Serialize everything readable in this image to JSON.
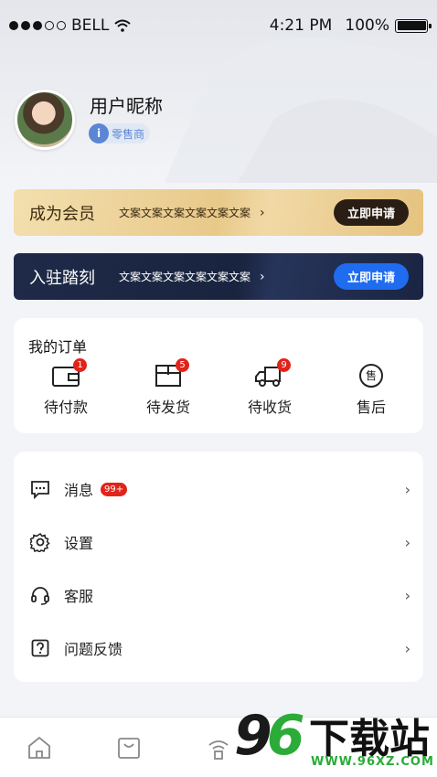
{
  "status_bar": {
    "carrier": "BELL",
    "time": "4:21 PM",
    "battery": "100%",
    "signal_bars_filled": 3,
    "signal_bars_total": 5
  },
  "profile": {
    "nickname": "用户昵称",
    "role_icon_text": "i",
    "role": "零售商"
  },
  "member_banner": {
    "title": "成为会员",
    "desc": "文案文案文案文案文案文案",
    "chevron": "›",
    "button": "立即申请"
  },
  "join_banner": {
    "title": "入驻踏刻",
    "desc": "文案文案文案文案文案文案",
    "chevron": "›",
    "button": "立即申请"
  },
  "orders": {
    "title": "我的订单",
    "items": [
      {
        "label": "待付款",
        "badge": "1",
        "icon": "wallet-icon"
      },
      {
        "label": "待发货",
        "badge": "5",
        "icon": "package-icon"
      },
      {
        "label": "待收货",
        "badge": "9",
        "icon": "truck-icon"
      },
      {
        "label": "售后",
        "badge": "",
        "icon": "after-sale-icon",
        "icon_text": "售"
      }
    ]
  },
  "menu": {
    "items": [
      {
        "label": "消息",
        "badge": "99+",
        "icon": "message-icon"
      },
      {
        "label": "设置",
        "badge": "",
        "icon": "gear-icon"
      },
      {
        "label": "客服",
        "badge": "",
        "icon": "headset-icon"
      },
      {
        "label": "问题反馈",
        "badge": "",
        "icon": "question-icon"
      }
    ],
    "arrow": "›"
  },
  "tabbar": {
    "icons": [
      "home-icon",
      "bag-icon",
      "broadcast-icon"
    ]
  },
  "watermark": {
    "digit1": "9",
    "digit2": "6",
    "text": "下载站",
    "url": "WWW.96XZ.COM"
  },
  "colors": {
    "gold_button": "#2a1e14",
    "navy_button": "#1f6cf0",
    "badge": "#e2231a",
    "role": "#5b86d6",
    "watermark_green": "#2bab37"
  }
}
